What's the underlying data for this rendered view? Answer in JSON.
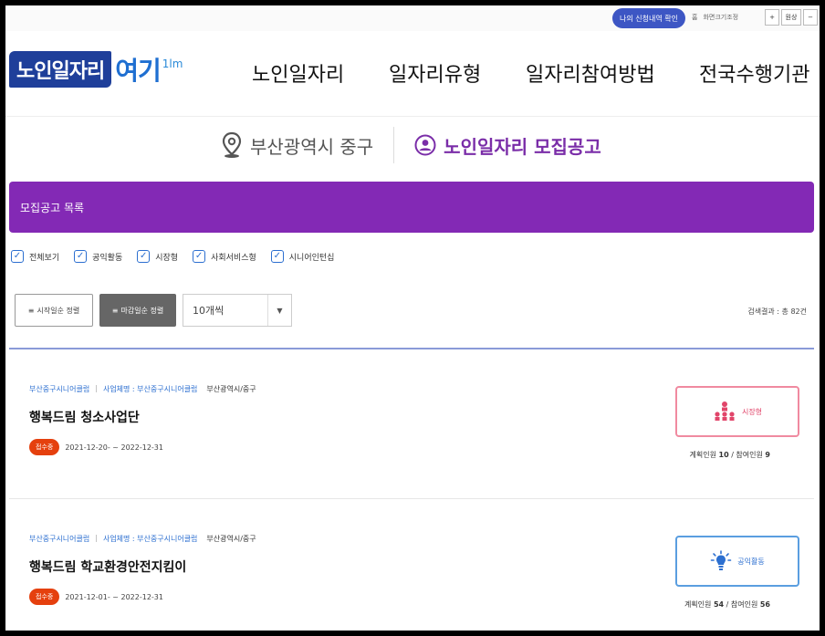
{
  "util": {
    "pill_label": "나의 신청내역 확인",
    "link_1": "홈",
    "link_2": "화면크기조정",
    "btn_plus": "+",
    "btn_reset": "원상",
    "btn_minus": "−"
  },
  "header": {
    "logo_main": "노인일자리",
    "logo_sub": "여기",
    "logo_mark": "1lm",
    "nav": [
      "노인일자리",
      "일자리유형",
      "일자리참여방법",
      "전국수행기관"
    ]
  },
  "location": {
    "region": "부산광역시 중구",
    "section": "노인일자리 모집공고"
  },
  "list_header": "모집공고 목록",
  "filters": [
    "전체보기",
    "공익활동",
    "시장형",
    "사회서비스형",
    "시니어인턴십"
  ],
  "sort": {
    "start_label": "시작일순 정렬",
    "end_label": "마감일순 정렬",
    "page_size": "10개씩"
  },
  "result_count": "검색결과 : 총 82건",
  "items": [
    {
      "org": "부산중구시니어클럽",
      "operator": "사업체명 : 부산중구시니어클럽",
      "region": "부산광역시/중구",
      "title": "행복드림 청소사업단",
      "badge": "접수중",
      "dates": "2021-12-20- ~ 2022-12-31",
      "type": "시장형",
      "counts_prefix": "계획인원",
      "planned": "10",
      "counts_sep": "/ 참여인원",
      "participants": "9"
    },
    {
      "org": "부산중구시니어클럽",
      "operator": "사업체명 : 부산중구시니어클럽",
      "region": "부산광역시/중구",
      "title": "행복드림 학교환경안전지킴이",
      "badge": "접수중",
      "dates": "2021-12-01- ~ 2022-12-31",
      "type": "공익활동",
      "counts_prefix": "계획인원",
      "planned": "54",
      "counts_sep": "/ 참여인원",
      "participants": "56"
    }
  ],
  "colors": {
    "purple": "#8329b5",
    "brand_blue": "#1f3f9a",
    "badge_orange": "#e5400e",
    "market_pink": "#e1456a",
    "public_blue": "#2c6fd0"
  }
}
